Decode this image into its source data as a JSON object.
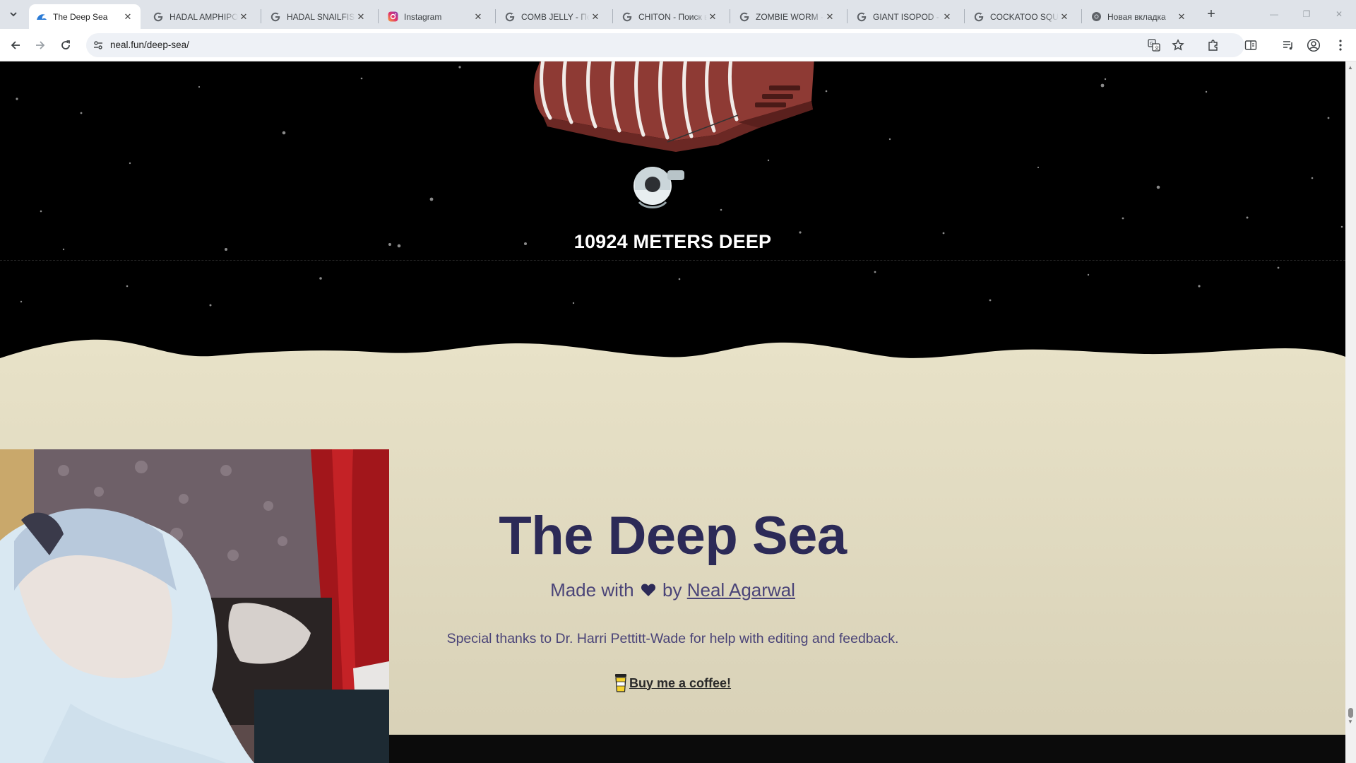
{
  "browser": {
    "tabs": [
      {
        "title": "The Deep Sea",
        "favicon": "neal-fun-wave-icon",
        "active": true
      },
      {
        "title": "HADAL AMPHIPOD",
        "favicon": "google-g-icon"
      },
      {
        "title": "HADAL SNAILFISH",
        "favicon": "google-g-icon"
      },
      {
        "title": "Instagram",
        "favicon": "instagram-icon"
      },
      {
        "title": "COMB JELLY - Поиск",
        "favicon": "google-g-icon"
      },
      {
        "title": "CHITON - Поиск в",
        "favicon": "google-g-icon"
      },
      {
        "title": "ZOMBIE WORM - П",
        "favicon": "google-g-icon"
      },
      {
        "title": "GIANT ISOPOD - П",
        "favicon": "google-g-icon"
      },
      {
        "title": "COCKATOO SQUID",
        "favicon": "google-g-icon"
      },
      {
        "title": "Новая вкладка",
        "favicon": "chrome-icon"
      }
    ],
    "url": "neal.fun/deep-sea/"
  },
  "page": {
    "depth_label": "10924 METERS DEEP",
    "title": "The Deep Sea",
    "made_with_prefix": "Made with",
    "made_with_by": "by",
    "author": "Neal Agarwal",
    "thanks": "Special thanks to Dr. Harri Pettitt-Wade for help with editing and feedback.",
    "coffee_label": "Buy me a coffee!"
  },
  "colors": {
    "sky": "#000000",
    "sand_top": "#e8e2c8",
    "sand_bottom": "#d8d1b6",
    "title": "#2c2a57",
    "subtitle": "#4a4478",
    "hull": "#8e3a34"
  }
}
